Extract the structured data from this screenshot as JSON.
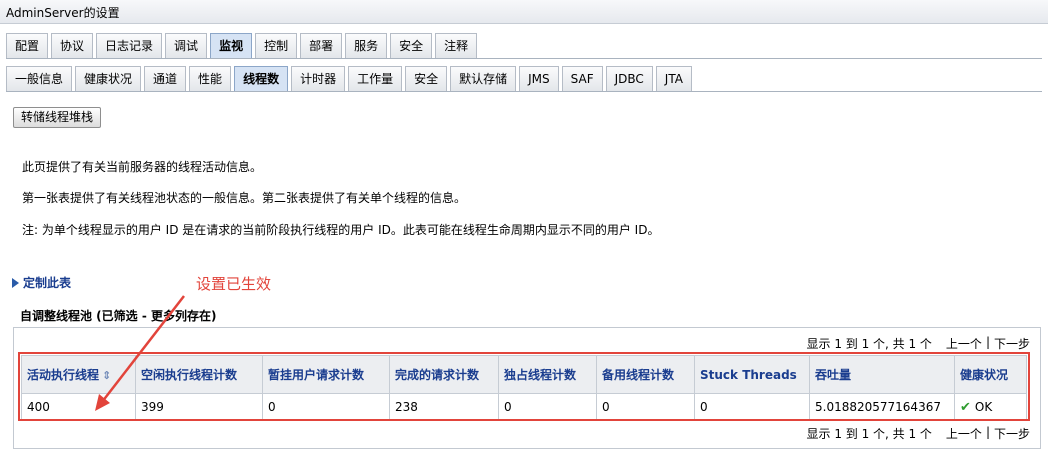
{
  "window": {
    "title": "AdminServer的设置"
  },
  "primary_tabs": [
    {
      "label": "配置",
      "active": false
    },
    {
      "label": "协议",
      "active": false
    },
    {
      "label": "日志记录",
      "active": false
    },
    {
      "label": "调试",
      "active": false
    },
    {
      "label": "监视",
      "active": true
    },
    {
      "label": "控制",
      "active": false
    },
    {
      "label": "部署",
      "active": false
    },
    {
      "label": "服务",
      "active": false
    },
    {
      "label": "安全",
      "active": false
    },
    {
      "label": "注释",
      "active": false
    }
  ],
  "secondary_tabs": [
    {
      "label": "一般信息",
      "active": false
    },
    {
      "label": "健康状况",
      "active": false
    },
    {
      "label": "通道",
      "active": false
    },
    {
      "label": "性能",
      "active": false
    },
    {
      "label": "线程数",
      "active": true
    },
    {
      "label": "计时器",
      "active": false
    },
    {
      "label": "工作量",
      "active": false
    },
    {
      "label": "安全",
      "active": false
    },
    {
      "label": "默认存储",
      "active": false
    },
    {
      "label": "JMS",
      "active": false
    },
    {
      "label": "SAF",
      "active": false
    },
    {
      "label": "JDBC",
      "active": false
    },
    {
      "label": "JTA",
      "active": false
    }
  ],
  "toolbar": {
    "dump_button_label": "转储线程堆栈"
  },
  "description": {
    "line1": "此页提供了有关当前服务器的线程活动信息。",
    "line2": "第一张表提供了有关线程池状态的一般信息。第二张表提供了有关单个线程的信息。",
    "line3": "注: 为单个线程显示的用户 ID 是在请求的当前阶段执行线程的用户 ID。此表可能在线程生命周期内显示不同的用户 ID。"
  },
  "customize": {
    "label": "定制此表"
  },
  "annotation": {
    "text": "设置已生效",
    "color": "#e2443b"
  },
  "pool_table": {
    "title": "自调整线程池 (已筛选 - 更多列存在)",
    "pager": {
      "range": "显示 1 到 1 个, 共 1 个",
      "prev": "上一个",
      "separator": "|",
      "next": "下一步"
    },
    "columns": [
      "活动执行线程",
      "空闲执行线程计数",
      "暂挂用户请求计数",
      "完成的请求计数",
      "独占线程计数",
      "备用线程计数",
      "Stuck Threads",
      "吞吐量",
      "健康状况"
    ],
    "sort_icon": "sort-arrows-icon",
    "rows": [
      [
        "400",
        "399",
        "0",
        "238",
        "0",
        "0",
        "0",
        "5.018820577164367",
        "OK"
      ]
    ],
    "status_icon": "check-icon"
  }
}
